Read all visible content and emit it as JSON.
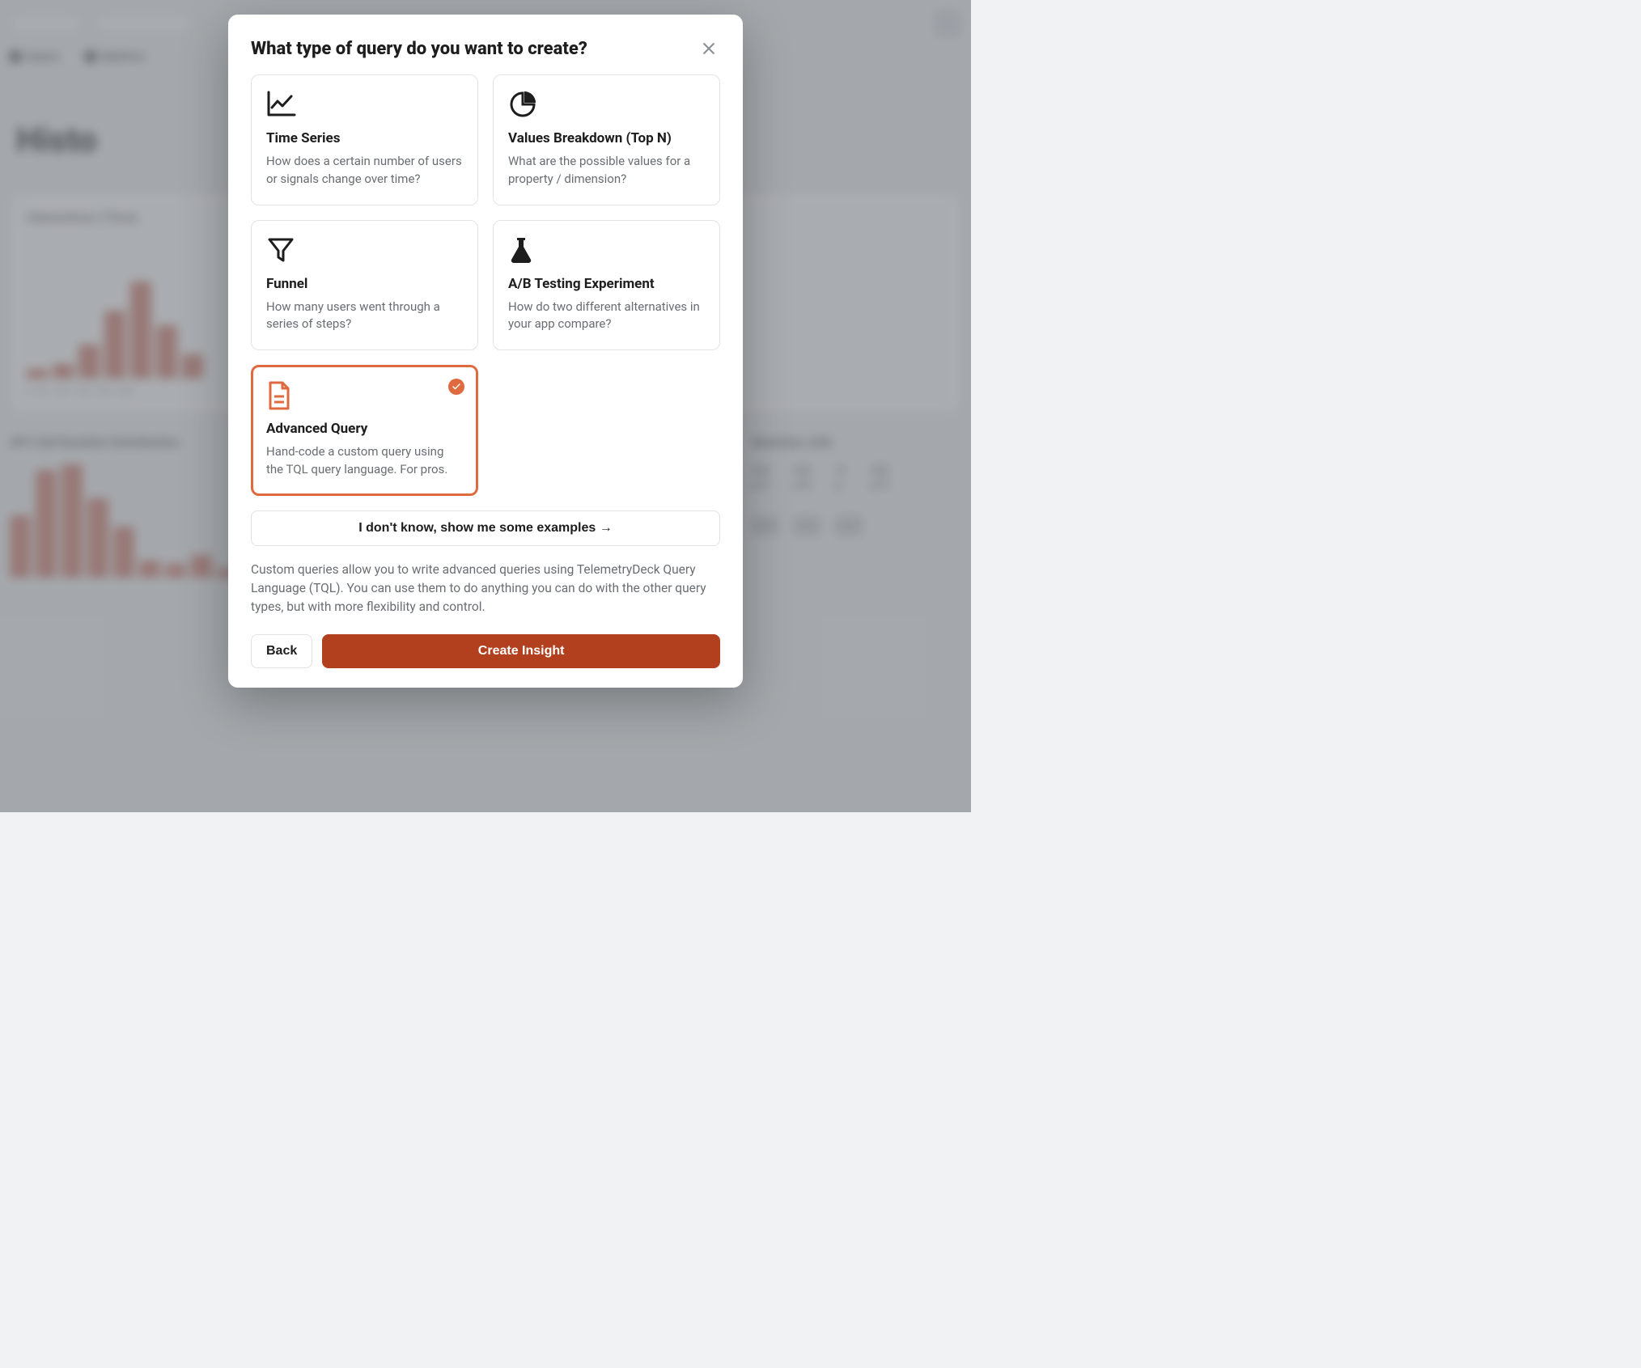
{
  "background": {
    "heading": "Histo",
    "card1_title": "Interactions (Time)",
    "card2a_title": "API Call Duration Distribution",
    "card2b_title": "Sketches (All)",
    "stats": [
      {
        "v": "0.0",
        "l": "p25"
      },
      {
        "v": "0.0",
        "l": "p50"
      },
      {
        "v": "0",
        "l": "p..."
      },
      {
        "v": "0.0",
        "l": "p95"
      }
    ],
    "xlabels": [
      "0",
      "50",
      "100",
      "150",
      "200",
      "250"
    ]
  },
  "modal": {
    "title": "What type of query do you want to create?",
    "options": [
      {
        "id": "time-series",
        "title": "Time Series",
        "desc": "How does a certain number of users or signals change over time?"
      },
      {
        "id": "values-breakdown",
        "title": "Values Breakdown (Top N)",
        "desc": "What are the possible values for a property / dimension?"
      },
      {
        "id": "funnel",
        "title": "Funnel",
        "desc": "How many users went through a series of steps?"
      },
      {
        "id": "ab-testing",
        "title": "A/B Testing Experiment",
        "desc": "How do two different alternatives in your app compare?"
      },
      {
        "id": "advanced-query",
        "title": "Advanced Query",
        "desc": "Hand-code a custom query using the TQL query language. For pros."
      }
    ],
    "selected": "advanced-query",
    "examples_label": "I don't know, show me some examples →",
    "explanation": "Custom queries allow you to write advanced queries using TelemetryDeck Query Language (TQL). You can use them to do anything you can do with the other query types, but with more flexibility and control.",
    "back_label": "Back",
    "submit_label": "Create Insight"
  }
}
